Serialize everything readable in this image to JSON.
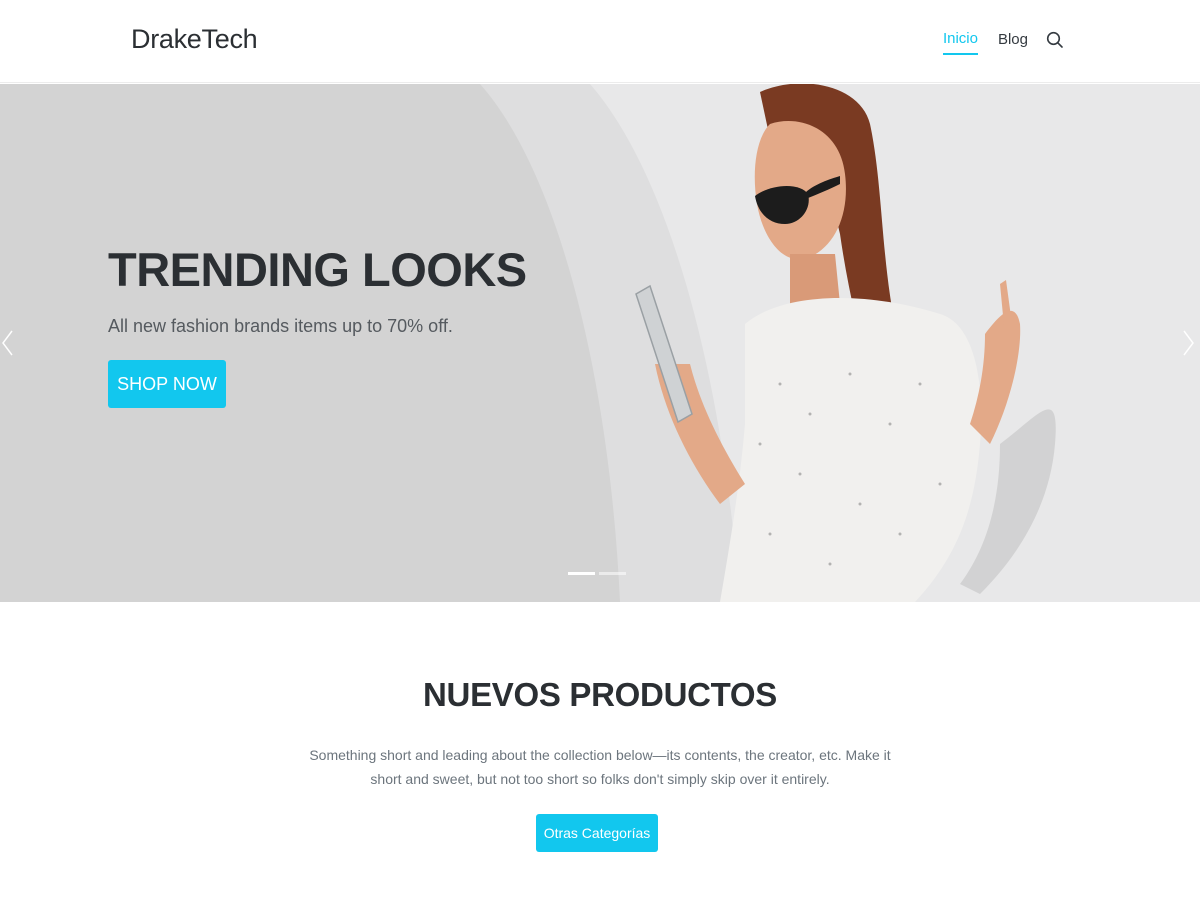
{
  "header": {
    "brand": "DrakeTech",
    "nav": {
      "inicio": "Inicio",
      "blog": "Blog"
    },
    "search_icon": "search-icon"
  },
  "hero": {
    "title": "TRENDING LOOKS",
    "subtitle": "All new fashion brands items up to 70% off.",
    "button": "SHOP NOW",
    "slides_total": 2,
    "active_slide": 1
  },
  "section": {
    "title": "NUEVOS PRODUCTOS",
    "description": "Something short and leading about the collection below—its contents, the creator, etc. Make it short and sweet, but not too short so folks don't simply skip over it entirely.",
    "button": "Otras Categorías"
  },
  "colors": {
    "accent": "#12c7ee",
    "text_dark": "#2b2f33",
    "hero_bg": "#d3d3d3"
  }
}
